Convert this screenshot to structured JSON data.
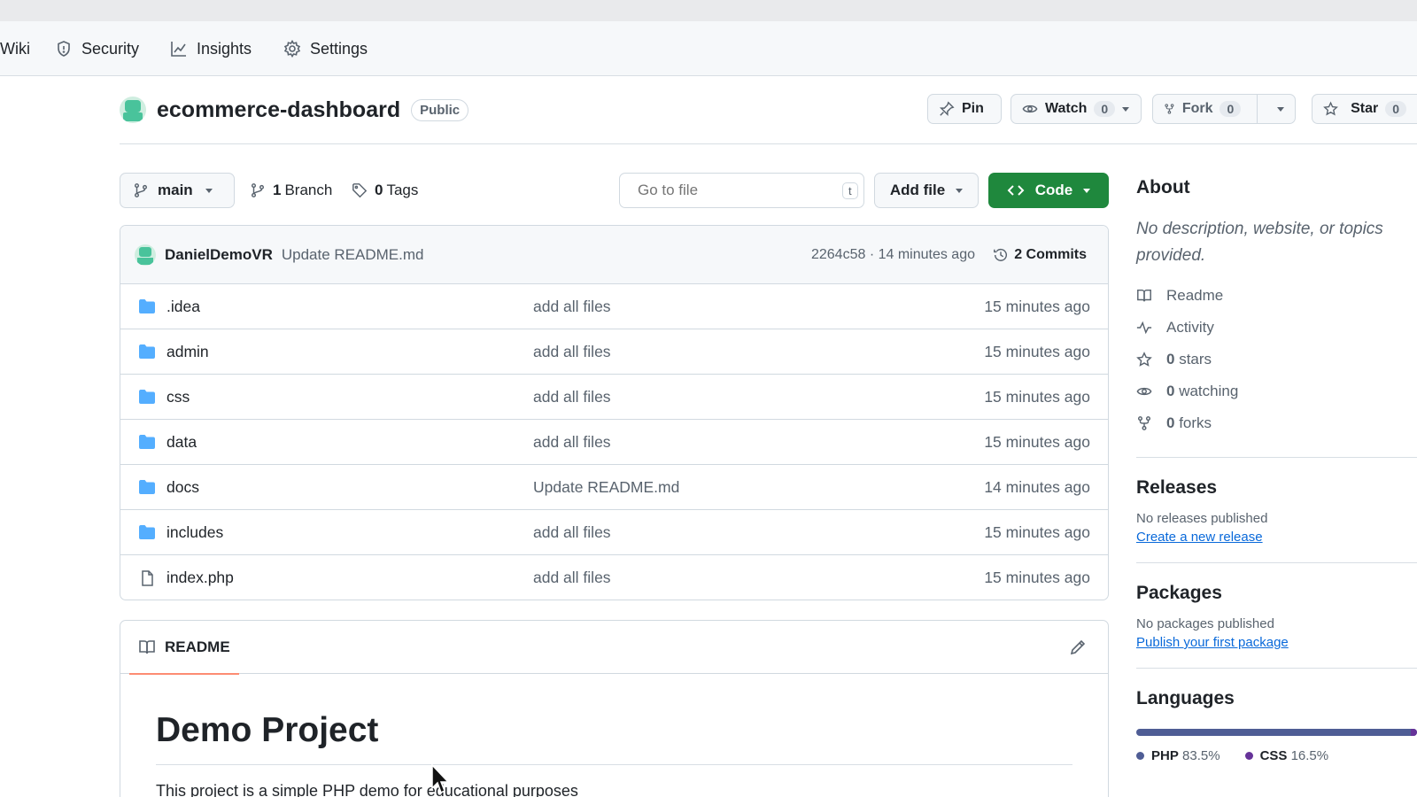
{
  "nav": {
    "items": [
      {
        "label": "Wiki",
        "icon": "none"
      },
      {
        "label": "Security",
        "icon": "shield-icon"
      },
      {
        "label": "Insights",
        "icon": "graph-icon"
      },
      {
        "label": "Settings",
        "icon": "gear-icon"
      }
    ]
  },
  "repo": {
    "name": "ecommerce-dashboard",
    "visibility": "Public"
  },
  "actions": {
    "pin": "Pin",
    "watch": "Watch",
    "watch_count": "0",
    "fork": "Fork",
    "fork_count": "0",
    "star": "Star",
    "star_count": "0"
  },
  "toolbar": {
    "branch": "main",
    "branches_count": "1",
    "branches_label": "Branch",
    "tags_count": "0",
    "tags_label": "Tags",
    "search_placeholder": "Go to file",
    "search_shortcut": "t",
    "add_file": "Add file",
    "code": "Code"
  },
  "commit": {
    "author": "DanielDemoVR",
    "message": "Update README.md",
    "meta": "2264c58 · 14 minutes ago",
    "count_label": "2 Commits"
  },
  "files": [
    {
      "name": ".idea",
      "type": "folder",
      "message": "add all files",
      "time": "15 minutes ago"
    },
    {
      "name": "admin",
      "type": "folder",
      "message": "add all files",
      "time": "15 minutes ago"
    },
    {
      "name": "css",
      "type": "folder",
      "message": "add all files",
      "time": "15 minutes ago"
    },
    {
      "name": "data",
      "type": "folder",
      "message": "add all files",
      "time": "15 minutes ago"
    },
    {
      "name": "docs",
      "type": "folder",
      "message": "Update README.md",
      "time": "14 minutes ago"
    },
    {
      "name": "includes",
      "type": "folder",
      "message": "add all files",
      "time": "15 minutes ago"
    },
    {
      "name": "index.php",
      "type": "file",
      "message": "add all files",
      "time": "15 minutes ago"
    }
  ],
  "readme": {
    "tab": "README",
    "title": "Demo Project",
    "text": "This project is a simple PHP demo for educational purposes"
  },
  "about": {
    "heading": "About",
    "description": "No description, website, or topics provided.",
    "items": [
      {
        "icon": "book-icon",
        "label": "Readme",
        "count": ""
      },
      {
        "icon": "pulse-icon",
        "label": "Activity",
        "count": ""
      },
      {
        "icon": "star-icon",
        "label": "stars",
        "count": "0"
      },
      {
        "icon": "eye-icon",
        "label": "watching",
        "count": "0"
      },
      {
        "icon": "fork-icon",
        "label": "forks",
        "count": "0"
      }
    ]
  },
  "releases": {
    "heading": "Releases",
    "empty": "No releases published",
    "link": "Create a new release"
  },
  "packages": {
    "heading": "Packages",
    "empty": "No packages published",
    "link": "Publish your first package"
  },
  "languages": {
    "heading": "Languages",
    "items": [
      {
        "name": "PHP",
        "percent": "83.5%",
        "color": "#4F5D95",
        "fraction": 0.835
      },
      {
        "name": "CSS",
        "percent": "16.5%",
        "color": "#663399",
        "fraction": 0.165
      }
    ]
  },
  "colors": {
    "accent_green": "#1f883d",
    "link_blue": "#0969da",
    "folder_blue": "#54aeff"
  }
}
